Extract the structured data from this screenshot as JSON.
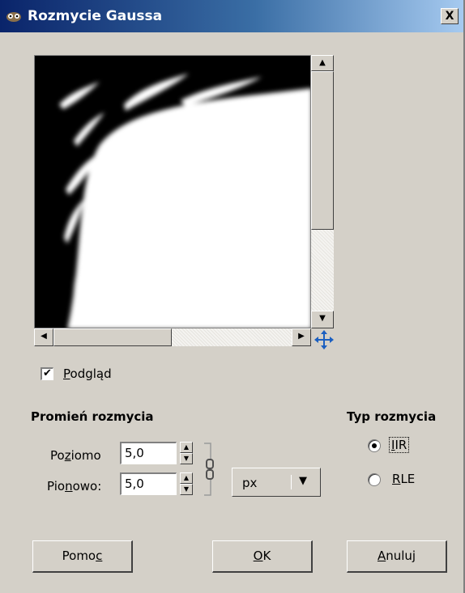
{
  "window": {
    "title": "Rozmycie Gaussa",
    "close_label": "X"
  },
  "preview": {
    "checkbox_label_pre": "",
    "checkbox_mnemonic": "P",
    "checkbox_label_post": "odgląd",
    "checked": true
  },
  "radius": {
    "title": "Promień rozmycia",
    "horizontal": {
      "pre": "Po",
      "mnemonic": "z",
      "post": "iomo",
      "value": "5,0"
    },
    "vertical": {
      "pre": "Pio",
      "mnemonic": "n",
      "post": "owo:",
      "value": "5,0"
    },
    "unit": "px"
  },
  "blur_type": {
    "title": "Typ rozmycia",
    "options": [
      {
        "mnemonic": "I",
        "rest": "IR",
        "selected": true
      },
      {
        "mnemonic": "R",
        "rest": "LE",
        "selected": false
      }
    ]
  },
  "buttons": {
    "help": {
      "pre": "Pomo",
      "mnemonic": "c",
      "post": ""
    },
    "ok": {
      "pre": "",
      "mnemonic": "O",
      "post": "K"
    },
    "cancel": {
      "pre": "",
      "mnemonic": "A",
      "post": "nuluj"
    }
  },
  "colors": {
    "title_start": "#0a246a",
    "title_end": "#a6caf0",
    "face": "#d4d0c8"
  }
}
